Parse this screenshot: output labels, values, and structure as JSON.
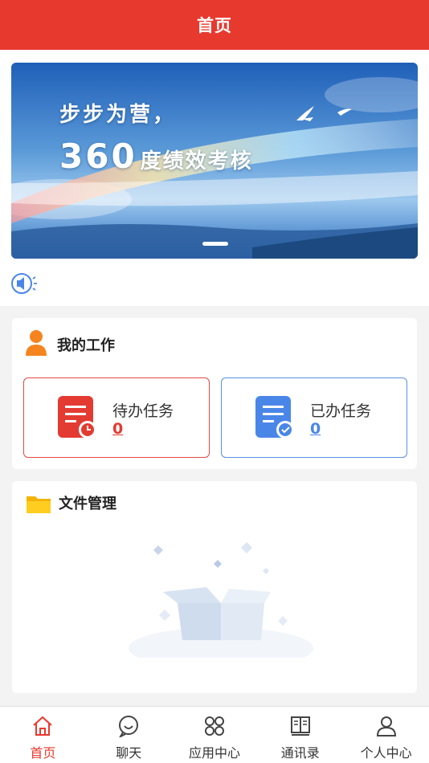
{
  "header": {
    "title": "首页"
  },
  "banner": {
    "line1": "步步为营，",
    "line2_number": "360",
    "line2_text": "度绩效考核"
  },
  "work": {
    "title": "我的工作",
    "pending": {
      "label": "待办任务",
      "count": "0"
    },
    "done": {
      "label": "已办任务",
      "count": "0"
    }
  },
  "files": {
    "title": "文件管理"
  },
  "tabbar": {
    "items": [
      {
        "label": "首页",
        "icon": "home-icon",
        "active": true
      },
      {
        "label": "聊天",
        "icon": "chat-icon"
      },
      {
        "label": "应用中心",
        "icon": "apps-icon"
      },
      {
        "label": "通讯录",
        "icon": "contacts-book-icon"
      },
      {
        "label": "个人中心",
        "icon": "user-icon"
      }
    ]
  },
  "colors": {
    "brand": "#e8392e",
    "pending": "#e33b32",
    "done": "#4a86e8"
  }
}
